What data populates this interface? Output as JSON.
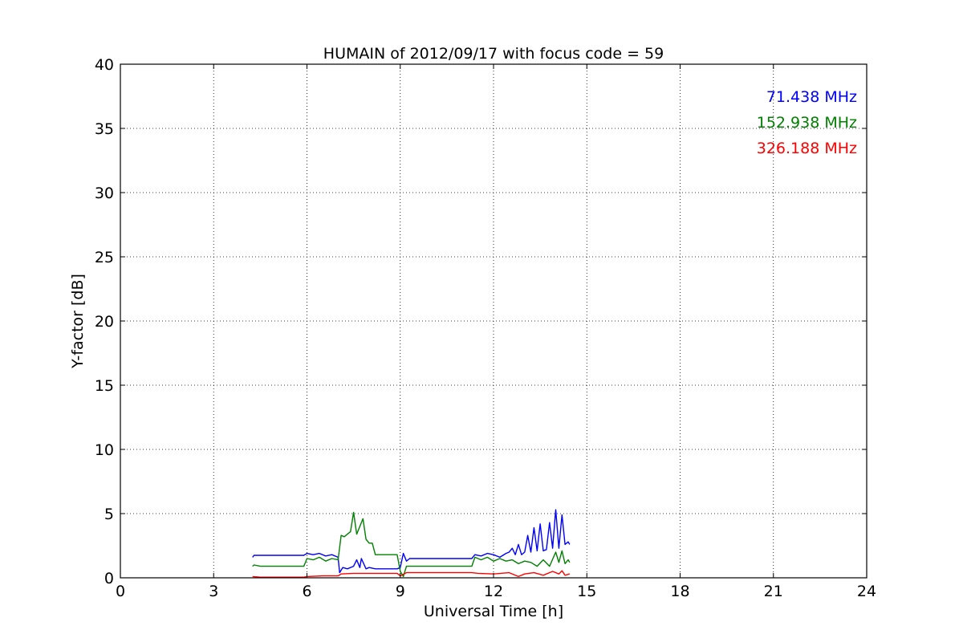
{
  "chart_data": {
    "type": "line",
    "title": "HUMAIN of 2012/09/17 with focus code = 59",
    "xlabel": "Universal Time [h]",
    "ylabel": "Y-factor [dB]",
    "xlim": [
      0,
      24
    ],
    "ylim": [
      0,
      40
    ],
    "xticks": [
      0,
      3,
      6,
      9,
      12,
      15,
      18,
      21,
      24
    ],
    "yticks": [
      0,
      5,
      10,
      15,
      20,
      25,
      30,
      35,
      40
    ],
    "grid": true,
    "legend_placement": "top-right",
    "series": [
      {
        "name": "71.438 MHz",
        "color": "#0000ff",
        "x": [
          4.25,
          4.3,
          4.5,
          5.9,
          6.0,
          6.2,
          6.4,
          6.6,
          6.8,
          7.0,
          7.05,
          7.15,
          7.3,
          7.5,
          7.6,
          7.7,
          7.75,
          7.9,
          8.0,
          8.2,
          8.5,
          8.9,
          9.0,
          9.1,
          9.2,
          9.3,
          9.5,
          10.5,
          11.3,
          11.4,
          11.6,
          11.8,
          12.0,
          12.2,
          12.4,
          12.5,
          12.6,
          12.7,
          12.8,
          12.9,
          13.0,
          13.1,
          13.2,
          13.3,
          13.4,
          13.5,
          13.6,
          13.7,
          13.8,
          13.9,
          14.0,
          14.1,
          14.2,
          14.3,
          14.4,
          14.45
        ],
        "y": [
          1.6,
          1.75,
          1.75,
          1.75,
          1.9,
          1.8,
          1.9,
          1.7,
          1.8,
          1.6,
          0.4,
          0.8,
          0.7,
          0.9,
          1.4,
          0.8,
          1.5,
          0.7,
          0.8,
          0.7,
          0.7,
          0.7,
          0.8,
          1.9,
          1.3,
          1.5,
          1.5,
          1.5,
          1.5,
          1.8,
          1.7,
          1.9,
          1.8,
          1.6,
          1.9,
          2.0,
          2.3,
          1.8,
          2.6,
          1.8,
          2.0,
          3.3,
          2.0,
          3.9,
          2.1,
          4.2,
          2.1,
          2.2,
          4.3,
          2.3,
          5.3,
          2.3,
          4.9,
          2.6,
          2.8,
          2.6
        ]
      },
      {
        "name": "152.938 MHz",
        "color": "#008000",
        "x": [
          4.25,
          4.3,
          4.5,
          5.9,
          6.0,
          6.2,
          6.4,
          6.6,
          6.8,
          7.0,
          7.1,
          7.2,
          7.4,
          7.5,
          7.6,
          7.7,
          7.8,
          7.9,
          8.0,
          8.1,
          8.2,
          8.5,
          8.9,
          9.0,
          9.1,
          9.2,
          9.3,
          9.5,
          10.5,
          11.3,
          11.4,
          11.6,
          11.8,
          12.0,
          12.2,
          12.4,
          12.6,
          12.8,
          13.0,
          13.2,
          13.4,
          13.6,
          13.8,
          14.0,
          14.1,
          14.2,
          14.3,
          14.4,
          14.45
        ],
        "y": [
          0.9,
          1.0,
          0.9,
          0.9,
          1.5,
          1.4,
          1.6,
          1.3,
          1.5,
          1.4,
          3.3,
          3.2,
          3.6,
          5.1,
          3.4,
          4.0,
          4.6,
          3.0,
          2.7,
          2.7,
          1.8,
          1.8,
          1.8,
          0.5,
          0.1,
          0.9,
          0.9,
          0.9,
          0.9,
          0.9,
          1.6,
          1.4,
          1.6,
          1.3,
          1.5,
          1.3,
          1.4,
          1.1,
          1.3,
          1.2,
          0.9,
          1.4,
          0.9,
          2.0,
          1.2,
          2.1,
          1.1,
          1.4,
          1.2
        ]
      },
      {
        "name": "326.188 MHz",
        "color": "#ff0000",
        "x": [
          4.25,
          4.5,
          5.9,
          6.0,
          6.5,
          7.0,
          7.1,
          7.5,
          8.0,
          8.5,
          8.9,
          9.0,
          9.2,
          9.5,
          10.5,
          11.3,
          11.5,
          12.0,
          12.5,
          12.8,
          13.0,
          13.3,
          13.6,
          13.9,
          14.1,
          14.2,
          14.3,
          14.45
        ],
        "y": [
          0.1,
          0.05,
          0.05,
          0.1,
          0.15,
          0.15,
          0.3,
          0.35,
          0.35,
          0.35,
          0.35,
          0.15,
          0.4,
          0.4,
          0.4,
          0.4,
          0.35,
          0.3,
          0.4,
          0.1,
          0.3,
          0.4,
          0.2,
          0.5,
          0.3,
          0.55,
          0.2,
          0.3
        ]
      }
    ]
  }
}
